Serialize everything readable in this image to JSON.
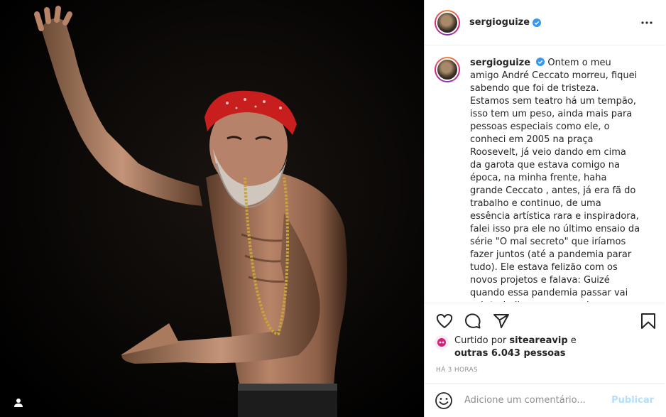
{
  "post": {
    "username": "sergioguize",
    "verified": true,
    "caption": "Ontem o meu amigo André Ceccato morreu, fiquei sabendo que foi de tristeza. Estamos sem teatro há um tempão, isso tem um peso, ainda mais para pessoas especiais como ele, o conheci em 2005 na praça Roosevelt, já veio dando em cima da garota que estava comigo na época, na minha frente, haha grande Ceccato , antes, já era fã do trabalho e continuo, de uma essência artística rara e inspiradora, falei isso pra ele no último ensaio da série \"O mal secreto\" que iríamos fazer juntos (até a pandemia parar tudo). Ele estava felizão com os novos projetos e falava: Guizé quando essa pandemia passar vai cair trabalho no nosso colo que",
    "likes_prefix": "Curtido por",
    "likes_user": "siteareavip",
    "likes_and": "e",
    "likes_others": "outras 6.043 pessoas",
    "timestamp": "HÁ 3 HORAS"
  },
  "comment": {
    "placeholder": "Adicione um comentário...",
    "publish_label": "Publicar"
  },
  "icons": {
    "like": "heart-icon",
    "comment": "comment-icon",
    "share": "share-icon",
    "save": "bookmark-icon",
    "more": "more-options-icon",
    "emoji": "emoji-icon",
    "tags": "user-tag-icon"
  },
  "colors": {
    "verified": "#3897f0",
    "publish_disabled": "#b2dffc",
    "secondary_text": "#8e8e8e"
  }
}
